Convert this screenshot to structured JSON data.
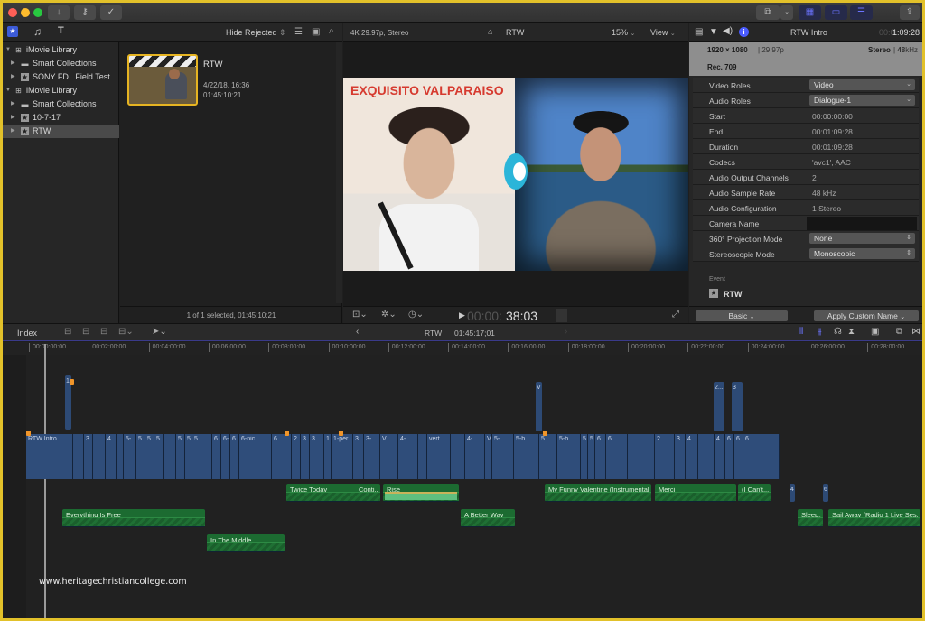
{
  "toolbar": {
    "import_icon": "↓",
    "keywords_icon": "⚷",
    "background_tasks_icon": "✓",
    "share_icon": "⇪"
  },
  "browser": {
    "filter": "Hide Rejected",
    "sidebar": [
      {
        "label": "iMovie Library",
        "type": "library",
        "expanded": true,
        "indent": 0
      },
      {
        "label": "Smart Collections",
        "type": "folder",
        "indent": 1
      },
      {
        "label": "SONY FD...Field Test",
        "type": "event",
        "indent": 1
      },
      {
        "label": "iMovie Library",
        "type": "library",
        "expanded": true,
        "indent": 0
      },
      {
        "label": "Smart Collections",
        "type": "folder",
        "indent": 1
      },
      {
        "label": "10-7-17",
        "type": "event",
        "indent": 1
      },
      {
        "label": "RTW",
        "type": "event",
        "indent": 1,
        "selected": true
      }
    ],
    "clip": {
      "name": "RTW",
      "date": "4/22/18, 16:36",
      "duration": "01:45:10:21"
    },
    "footer": "1 of 1 selected, 01:45:10:21"
  },
  "viewer": {
    "format": "4K 29.97p, Stereo",
    "title": "RTW",
    "zoom": "15%",
    "view_label": "View",
    "timecode_dim": "00:00:",
    "timecode": "38:03",
    "poster_text": "EXQUISITO VALPARAISO"
  },
  "inspector": {
    "clip_name": "RTW Intro",
    "duration_dim": "00:0",
    "duration": "1:09:28",
    "resolution": "1920 × 1080",
    "frame_rate": "29.97p",
    "audio": "Stereo",
    "sample": "48",
    "sample_unit": "kHz",
    "color_space": "Rec. 709",
    "rows": [
      {
        "key": "Video Roles",
        "value": "Video",
        "kind": "dropdown"
      },
      {
        "key": "Audio Roles",
        "value": "Dialogue-1",
        "kind": "dropdown"
      },
      {
        "key": "Start",
        "value": "00:00:00:00",
        "kind": "text"
      },
      {
        "key": "End",
        "value": "00:01:09:28",
        "kind": "text"
      },
      {
        "key": "Duration",
        "value": "00:01:09:28",
        "kind": "text"
      },
      {
        "key": "Codecs",
        "value": "'avc1', AAC",
        "kind": "text"
      },
      {
        "key": "Audio Output Channels",
        "value": "2",
        "kind": "text"
      },
      {
        "key": "Audio Sample Rate",
        "value": "48 kHz",
        "kind": "text"
      },
      {
        "key": "Audio Configuration",
        "value": "1 Stereo",
        "kind": "text"
      },
      {
        "key": "Camera Name",
        "value": "",
        "kind": "field"
      },
      {
        "key": "360° Projection Mode",
        "value": "None",
        "kind": "stepper"
      },
      {
        "key": "Stereoscopic Mode",
        "value": "Monoscopic",
        "kind": "stepper"
      }
    ],
    "event_label": "Event",
    "event_name": "RTW",
    "basic_label": "Basic",
    "apply_label": "Apply Custom Name"
  },
  "timeline": {
    "index_label": "Index",
    "project": "RTW",
    "project_duration": "01:45:17;01",
    "ruler": [
      "00:00:00:00",
      "00:02:00:00",
      "00:04:00:00",
      "00:06:00:00",
      "00:08:00:00",
      "00:10:00:00",
      "00:12:00:00",
      "00:14:00:00",
      "00:16:00:00",
      "00:18:00:00",
      "00:20:00:00",
      "00:22:00:00",
      "00:24:00:00",
      "00:26:00:00",
      "00:28:00:00"
    ],
    "primary_clips": [
      "RTW Intro",
      "...",
      "3",
      "...",
      "4",
      "",
      "5-",
      "5",
      "5",
      "5",
      "...",
      "5",
      "5",
      "5...",
      "6",
      "6-",
      "6",
      "6-nic...",
      "6...",
      "2",
      "3",
      "3...",
      "1",
      "1-per...",
      "3",
      "3-...",
      "V...",
      "4-...",
      "...",
      "vert...",
      "...",
      "4-...",
      "V",
      "5-...",
      "5-b...",
      "5...",
      "5-b...",
      "5",
      "5",
      "6",
      "6...",
      "...",
      "2...",
      "3",
      "4",
      "...",
      "4",
      "6",
      "6",
      "6"
    ],
    "connected_clips": [
      "1",
      "V",
      "2...",
      "3"
    ],
    "audio_clips": [
      {
        "name": "Twice Today",
        "lane": 1
      },
      {
        "name": "Conti...",
        "lane": 1
      },
      {
        "name": "Rise",
        "lane": 1
      },
      {
        "name": "My Funny Valentine (Instrumental)",
        "lane": 1
      },
      {
        "name": "Merci",
        "lane": 1
      },
      {
        "name": "(I Can't...",
        "lane": 1
      },
      {
        "name": "Everything Is Free",
        "lane": 2
      },
      {
        "name": "A Better Way",
        "lane": 2
      },
      {
        "name": "Sleep...",
        "lane": 2
      },
      {
        "name": "Sail Away (Radio 1 Live Ses...",
        "lane": 2
      },
      {
        "name": "In The Middle",
        "lane": 3
      }
    ],
    "small_clips": [
      "4",
      "6"
    ]
  },
  "watermark": "www.heritagechristiancollege.com",
  "colors": {
    "accent": "#6c74ff",
    "selection": "#e6b422",
    "video_clip": "#2f4d7a",
    "audio_clip": "#1c6b31",
    "marker": "#f0952a"
  }
}
